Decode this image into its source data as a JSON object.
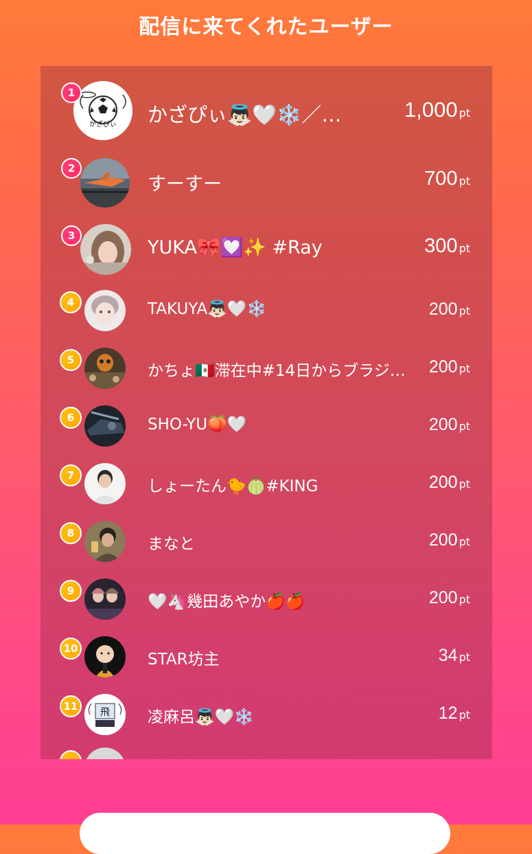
{
  "header": {
    "title": "配信に来てくれたユーザー"
  },
  "users": [
    {
      "rank": "1",
      "name": "かざぴぃ👼🏻🤍❄️／…",
      "points": "1,000",
      "unit": "pt",
      "avatar": "soccer-ball-avatar"
    },
    {
      "rank": "2",
      "name": "すーすー",
      "points": "700",
      "unit": "pt",
      "avatar": "airplane-photo-avatar"
    },
    {
      "rank": "3",
      "name": "YUKA🎀💟✨ #Ray",
      "points": "300",
      "unit": "pt",
      "avatar": "woman-photo-avatar"
    },
    {
      "rank": "4",
      "name": "TAKUYA👼🏻🤍❄️",
      "points": "200",
      "unit": "pt",
      "avatar": "illustrated-boy-avatar"
    },
    {
      "rank": "5",
      "name": "かちょ🇲🇽滞在中#14日からブラジ…",
      "points": "200",
      "unit": "pt",
      "avatar": "skull-mask-avatar"
    },
    {
      "rank": "6",
      "name": "SHO-YU🍑🤍",
      "points": "200",
      "unit": "pt",
      "avatar": "car-photo-avatar"
    },
    {
      "rank": "7",
      "name": "しょーたん🐤🍈#KING",
      "points": "200",
      "unit": "pt",
      "avatar": "man-photo-avatar"
    },
    {
      "rank": "8",
      "name": "まなと",
      "points": "200",
      "unit": "pt",
      "avatar": "man-drinking-avatar"
    },
    {
      "rank": "9",
      "name": "🤍🦄幾田あやか🍎🍎",
      "points": "200",
      "unit": "pt",
      "avatar": "concert-photo-avatar"
    },
    {
      "rank": "10",
      "name": "STAR坊主",
      "points": "34",
      "unit": "pt",
      "avatar": "cartoon-monk-avatar"
    },
    {
      "rank": "11",
      "name": "凌麻呂👼🏻🤍❄️",
      "points": "12",
      "unit": "pt",
      "avatar": "kanji-logo-avatar"
    }
  ],
  "colors": {
    "background_top": "#ff7a3a",
    "background_bottom": "#ff3f93",
    "top_rank_badge": "#ff3f7a",
    "rank_badge": "#ffb000"
  }
}
